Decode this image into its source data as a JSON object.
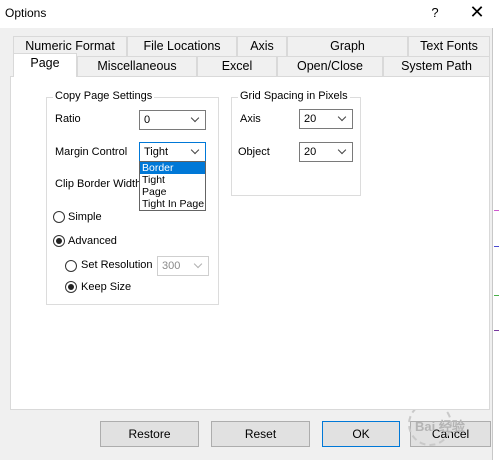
{
  "window": {
    "title": "Options",
    "help_label": "?",
    "close_label": "✕"
  },
  "tabs_row1": [
    "Numeric Format",
    "File Locations",
    "Axis",
    "Graph",
    "Text Fonts"
  ],
  "tabs_row2": [
    "Page",
    "Miscellaneous",
    "Excel",
    "Open/Close",
    "System Path"
  ],
  "active_tab": "Page",
  "copy_page": {
    "group_title": "Copy Page Settings",
    "ratio_label": "Ratio",
    "ratio_value": "0",
    "margin_label": "Margin Control",
    "margin_value": "Tight",
    "margin_options": [
      "Border",
      "Tight",
      "Page",
      "Tight In Page"
    ],
    "margin_highlighted": "Border",
    "clip_label": "Clip Border Width",
    "simple_label": "Simple",
    "advanced_label": "Advanced",
    "mode_selected": "Advanced",
    "set_resolution_label": "Set Resolution",
    "resolution_value": "300",
    "keep_size_label": "Keep Size",
    "sub_selected": "Keep Size"
  },
  "grid_spacing": {
    "group_title": "Grid Spacing in Pixels",
    "axis_label": "Axis",
    "axis_value": "20",
    "object_label": "Object",
    "object_value": "20"
  },
  "buttons": {
    "restore": "Restore",
    "reset": "Reset",
    "ok": "OK",
    "cancel": "Cancel"
  },
  "watermark": {
    "text": "Bai 经验"
  },
  "colors": {
    "accent": "#0078d7",
    "highlight": "#0078d7"
  }
}
